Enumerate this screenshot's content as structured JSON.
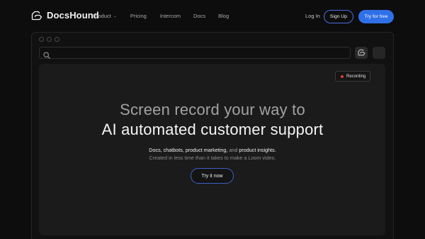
{
  "nav": {
    "brand": "DocsHound",
    "links": [
      {
        "label": "Product",
        "has_dropdown": true
      },
      {
        "label": "Pricing"
      },
      {
        "label": "Intercom"
      },
      {
        "label": "Docs"
      },
      {
        "label": "Blog"
      }
    ],
    "login": "Log In",
    "signup": "Sign Up",
    "try_free": "Try for free"
  },
  "recording_badge": "Recording",
  "hero": {
    "line1": "Screen record your way to",
    "line2": "AI automated customer support",
    "sub_parts": {
      "docs": "Docs,",
      "chatbots": "chatbots,",
      "product_marketing": "product marketing,",
      "and": "and",
      "product_insights": "product insights",
      "period": "."
    },
    "sub2": "Created in less time than it takes to make a Loom video.",
    "cta": "Try it now"
  },
  "colors": {
    "background": "#0d0d0d",
    "accent": "#2f6fe8",
    "recording": "#e53935"
  }
}
